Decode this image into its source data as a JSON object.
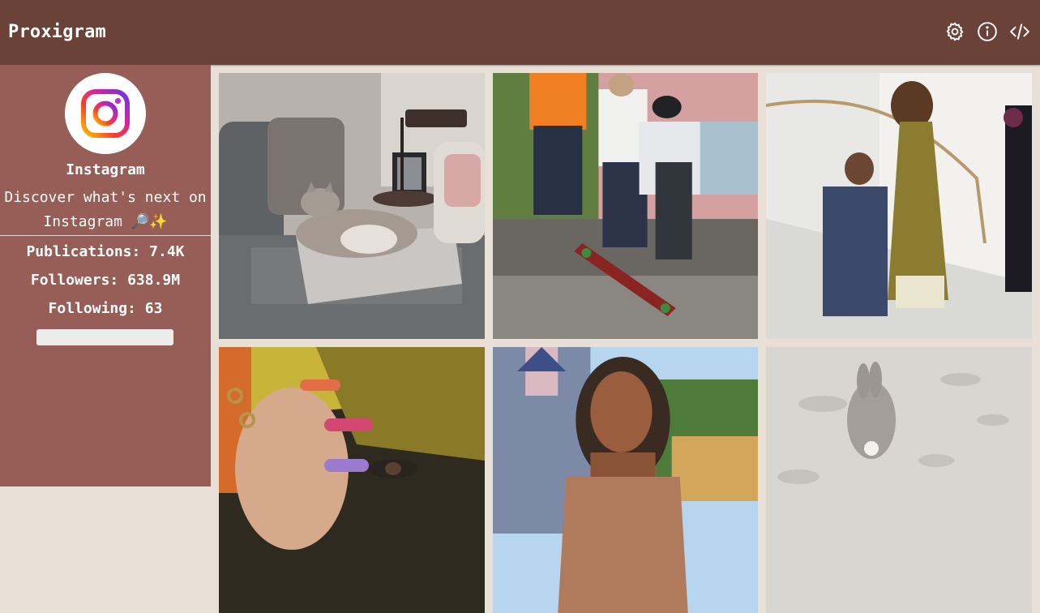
{
  "app": {
    "title": "Proxigram"
  },
  "header": {
    "icons": [
      "gear-icon",
      "info-icon",
      "code-icon"
    ]
  },
  "profile": {
    "name": "Instagram",
    "bio": "Discover what's next on Instagram 🔎✨",
    "avatar_icon": "instagram-logo",
    "stats": {
      "publications": "Publications: 7.4K",
      "followers": "Followers: 638.9M",
      "following": "Following: 63"
    }
  },
  "colors": {
    "header_bg": "#6a4238",
    "sidebar_bg": "#965e56",
    "page_bg": "#e8e0d6",
    "text": "#ffffff"
  },
  "posts": [
    {
      "subject": "cat-on-couch"
    },
    {
      "subject": "skateboarders"
    },
    {
      "subject": "couple-on-stairs"
    },
    {
      "subject": "painted-nails-closeup"
    },
    {
      "subject": "woman-at-castle"
    },
    {
      "subject": "bunny-in-snow"
    }
  ]
}
